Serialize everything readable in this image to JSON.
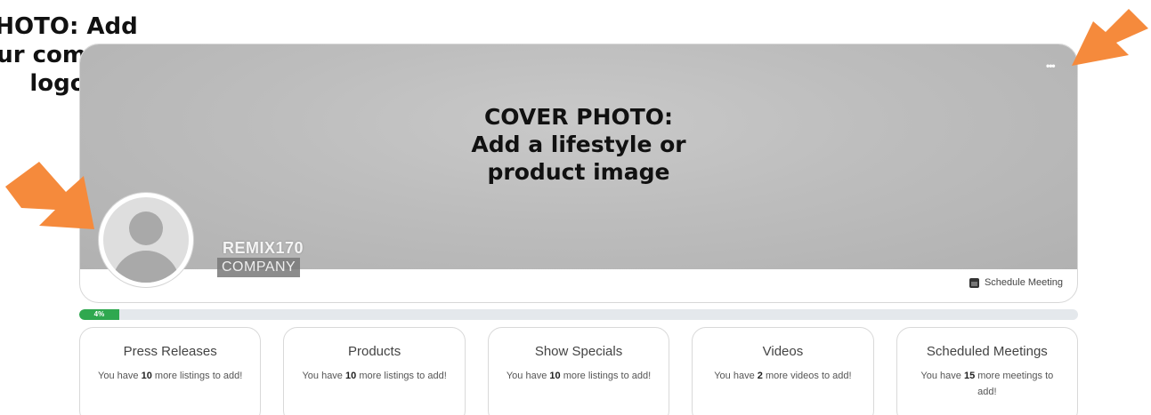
{
  "annotations": {
    "logo_line1": "PHOTO: Add",
    "logo_line2": "your company",
    "logo_line3": "logo",
    "cover_line1": "COVER PHOTO:",
    "cover_line2": "Add a lifestyle or",
    "cover_line3": "product image",
    "arrow_color": "#f58a3c"
  },
  "profile": {
    "company_name": "REMIX170",
    "company_type": "COMPANY",
    "menu_icon": "more-dots-icon",
    "schedule_meeting_label": "Schedule Meeting",
    "schedule_icon": "calendar-icon"
  },
  "progress": {
    "label": "4%",
    "value": 0.04,
    "color": "#2fa84f"
  },
  "cards": [
    {
      "title": "Press Releases",
      "prefix": "You have",
      "count": "10",
      "suffix": "more listings to add!"
    },
    {
      "title": "Products",
      "prefix": "You have",
      "count": "10",
      "suffix": "more listings to add!"
    },
    {
      "title": "Show Specials",
      "prefix": "You have",
      "count": "10",
      "suffix": "more listings to add!"
    },
    {
      "title": "Videos",
      "prefix": "You have",
      "count": "2",
      "suffix": "more videos to add!"
    },
    {
      "title": "Scheduled Meetings",
      "prefix": "You have",
      "count": "15",
      "suffix": "more meetings to add!"
    }
  ]
}
